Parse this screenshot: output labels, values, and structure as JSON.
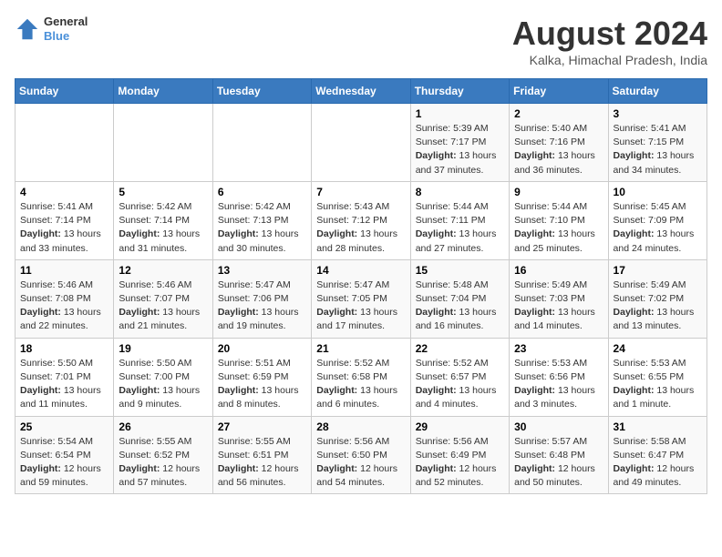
{
  "header": {
    "logo_line1": "General",
    "logo_line2": "Blue",
    "month_year": "August 2024",
    "location": "Kalka, Himachal Pradesh, India"
  },
  "weekdays": [
    "Sunday",
    "Monday",
    "Tuesday",
    "Wednesday",
    "Thursday",
    "Friday",
    "Saturday"
  ],
  "weeks": [
    [
      {
        "day": "",
        "detail": ""
      },
      {
        "day": "",
        "detail": ""
      },
      {
        "day": "",
        "detail": ""
      },
      {
        "day": "",
        "detail": ""
      },
      {
        "day": "1",
        "detail": "Sunrise: 5:39 AM\nSunset: 7:17 PM\nDaylight: 13 hours\nand 37 minutes."
      },
      {
        "day": "2",
        "detail": "Sunrise: 5:40 AM\nSunset: 7:16 PM\nDaylight: 13 hours\nand 36 minutes."
      },
      {
        "day": "3",
        "detail": "Sunrise: 5:41 AM\nSunset: 7:15 PM\nDaylight: 13 hours\nand 34 minutes."
      }
    ],
    [
      {
        "day": "4",
        "detail": "Sunrise: 5:41 AM\nSunset: 7:14 PM\nDaylight: 13 hours\nand 33 minutes."
      },
      {
        "day": "5",
        "detail": "Sunrise: 5:42 AM\nSunset: 7:14 PM\nDaylight: 13 hours\nand 31 minutes."
      },
      {
        "day": "6",
        "detail": "Sunrise: 5:42 AM\nSunset: 7:13 PM\nDaylight: 13 hours\nand 30 minutes."
      },
      {
        "day": "7",
        "detail": "Sunrise: 5:43 AM\nSunset: 7:12 PM\nDaylight: 13 hours\nand 28 minutes."
      },
      {
        "day": "8",
        "detail": "Sunrise: 5:44 AM\nSunset: 7:11 PM\nDaylight: 13 hours\nand 27 minutes."
      },
      {
        "day": "9",
        "detail": "Sunrise: 5:44 AM\nSunset: 7:10 PM\nDaylight: 13 hours\nand 25 minutes."
      },
      {
        "day": "10",
        "detail": "Sunrise: 5:45 AM\nSunset: 7:09 PM\nDaylight: 13 hours\nand 24 minutes."
      }
    ],
    [
      {
        "day": "11",
        "detail": "Sunrise: 5:46 AM\nSunset: 7:08 PM\nDaylight: 13 hours\nand 22 minutes."
      },
      {
        "day": "12",
        "detail": "Sunrise: 5:46 AM\nSunset: 7:07 PM\nDaylight: 13 hours\nand 21 minutes."
      },
      {
        "day": "13",
        "detail": "Sunrise: 5:47 AM\nSunset: 7:06 PM\nDaylight: 13 hours\nand 19 minutes."
      },
      {
        "day": "14",
        "detail": "Sunrise: 5:47 AM\nSunset: 7:05 PM\nDaylight: 13 hours\nand 17 minutes."
      },
      {
        "day": "15",
        "detail": "Sunrise: 5:48 AM\nSunset: 7:04 PM\nDaylight: 13 hours\nand 16 minutes."
      },
      {
        "day": "16",
        "detail": "Sunrise: 5:49 AM\nSunset: 7:03 PM\nDaylight: 13 hours\nand 14 minutes."
      },
      {
        "day": "17",
        "detail": "Sunrise: 5:49 AM\nSunset: 7:02 PM\nDaylight: 13 hours\nand 13 minutes."
      }
    ],
    [
      {
        "day": "18",
        "detail": "Sunrise: 5:50 AM\nSunset: 7:01 PM\nDaylight: 13 hours\nand 11 minutes."
      },
      {
        "day": "19",
        "detail": "Sunrise: 5:50 AM\nSunset: 7:00 PM\nDaylight: 13 hours\nand 9 minutes."
      },
      {
        "day": "20",
        "detail": "Sunrise: 5:51 AM\nSunset: 6:59 PM\nDaylight: 13 hours\nand 8 minutes."
      },
      {
        "day": "21",
        "detail": "Sunrise: 5:52 AM\nSunset: 6:58 PM\nDaylight: 13 hours\nand 6 minutes."
      },
      {
        "day": "22",
        "detail": "Sunrise: 5:52 AM\nSunset: 6:57 PM\nDaylight: 13 hours\nand 4 minutes."
      },
      {
        "day": "23",
        "detail": "Sunrise: 5:53 AM\nSunset: 6:56 PM\nDaylight: 13 hours\nand 3 minutes."
      },
      {
        "day": "24",
        "detail": "Sunrise: 5:53 AM\nSunset: 6:55 PM\nDaylight: 13 hours\nand 1 minute."
      }
    ],
    [
      {
        "day": "25",
        "detail": "Sunrise: 5:54 AM\nSunset: 6:54 PM\nDaylight: 12 hours\nand 59 minutes."
      },
      {
        "day": "26",
        "detail": "Sunrise: 5:55 AM\nSunset: 6:52 PM\nDaylight: 12 hours\nand 57 minutes."
      },
      {
        "day": "27",
        "detail": "Sunrise: 5:55 AM\nSunset: 6:51 PM\nDaylight: 12 hours\nand 56 minutes."
      },
      {
        "day": "28",
        "detail": "Sunrise: 5:56 AM\nSunset: 6:50 PM\nDaylight: 12 hours\nand 54 minutes."
      },
      {
        "day": "29",
        "detail": "Sunrise: 5:56 AM\nSunset: 6:49 PM\nDaylight: 12 hours\nand 52 minutes."
      },
      {
        "day": "30",
        "detail": "Sunrise: 5:57 AM\nSunset: 6:48 PM\nDaylight: 12 hours\nand 50 minutes."
      },
      {
        "day": "31",
        "detail": "Sunrise: 5:58 AM\nSunset: 6:47 PM\nDaylight: 12 hours\nand 49 minutes."
      }
    ]
  ]
}
